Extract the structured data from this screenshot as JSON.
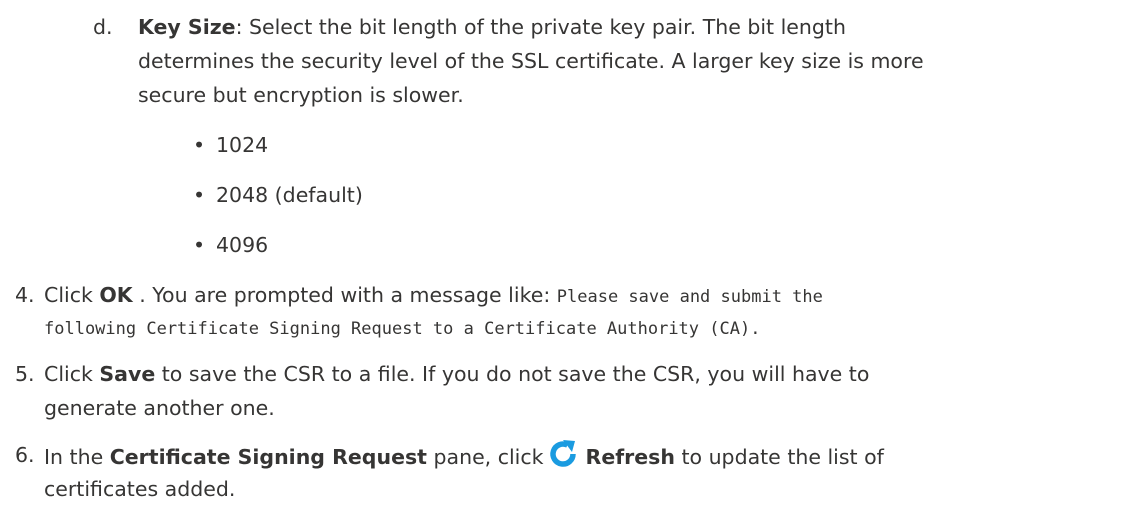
{
  "step_d": {
    "marker": "d.",
    "term": "Key Size",
    "text_1": ": Select the bit length of the private key pair. The bit length",
    "line_2": "determines the security level of the SSL certificate. A larger key size is more",
    "line_3": "secure but encryption is slower."
  },
  "key_sizes": [
    "1024",
    "2048 (default)",
    "4096"
  ],
  "bullet_char": "•",
  "step_4": {
    "marker": "4.",
    "pre": "Click ",
    "bold": "OK",
    "post": " . You are prompted with a message like: ",
    "code_1": "Please save and submit the",
    "code_2": "following Certificate Signing Request to a Certificate Authority (CA)."
  },
  "step_5": {
    "marker": "5.",
    "pre": "Click ",
    "bold": "Save",
    "post": " to save the CSR to a file. If you do not save the CSR, you will have to",
    "line_2": "generate another one."
  },
  "step_6": {
    "marker": "6.",
    "pre": "In the ",
    "bold_pane": "Certificate Signing Request",
    "mid": " pane, click",
    "bold_refresh": "Refresh",
    "post": " to update the list of",
    "line_2": "certificates added."
  },
  "icons": {
    "refresh": "refresh-icon"
  },
  "colors": {
    "text": "#363534",
    "refresh_icon": "#1a9be0"
  }
}
